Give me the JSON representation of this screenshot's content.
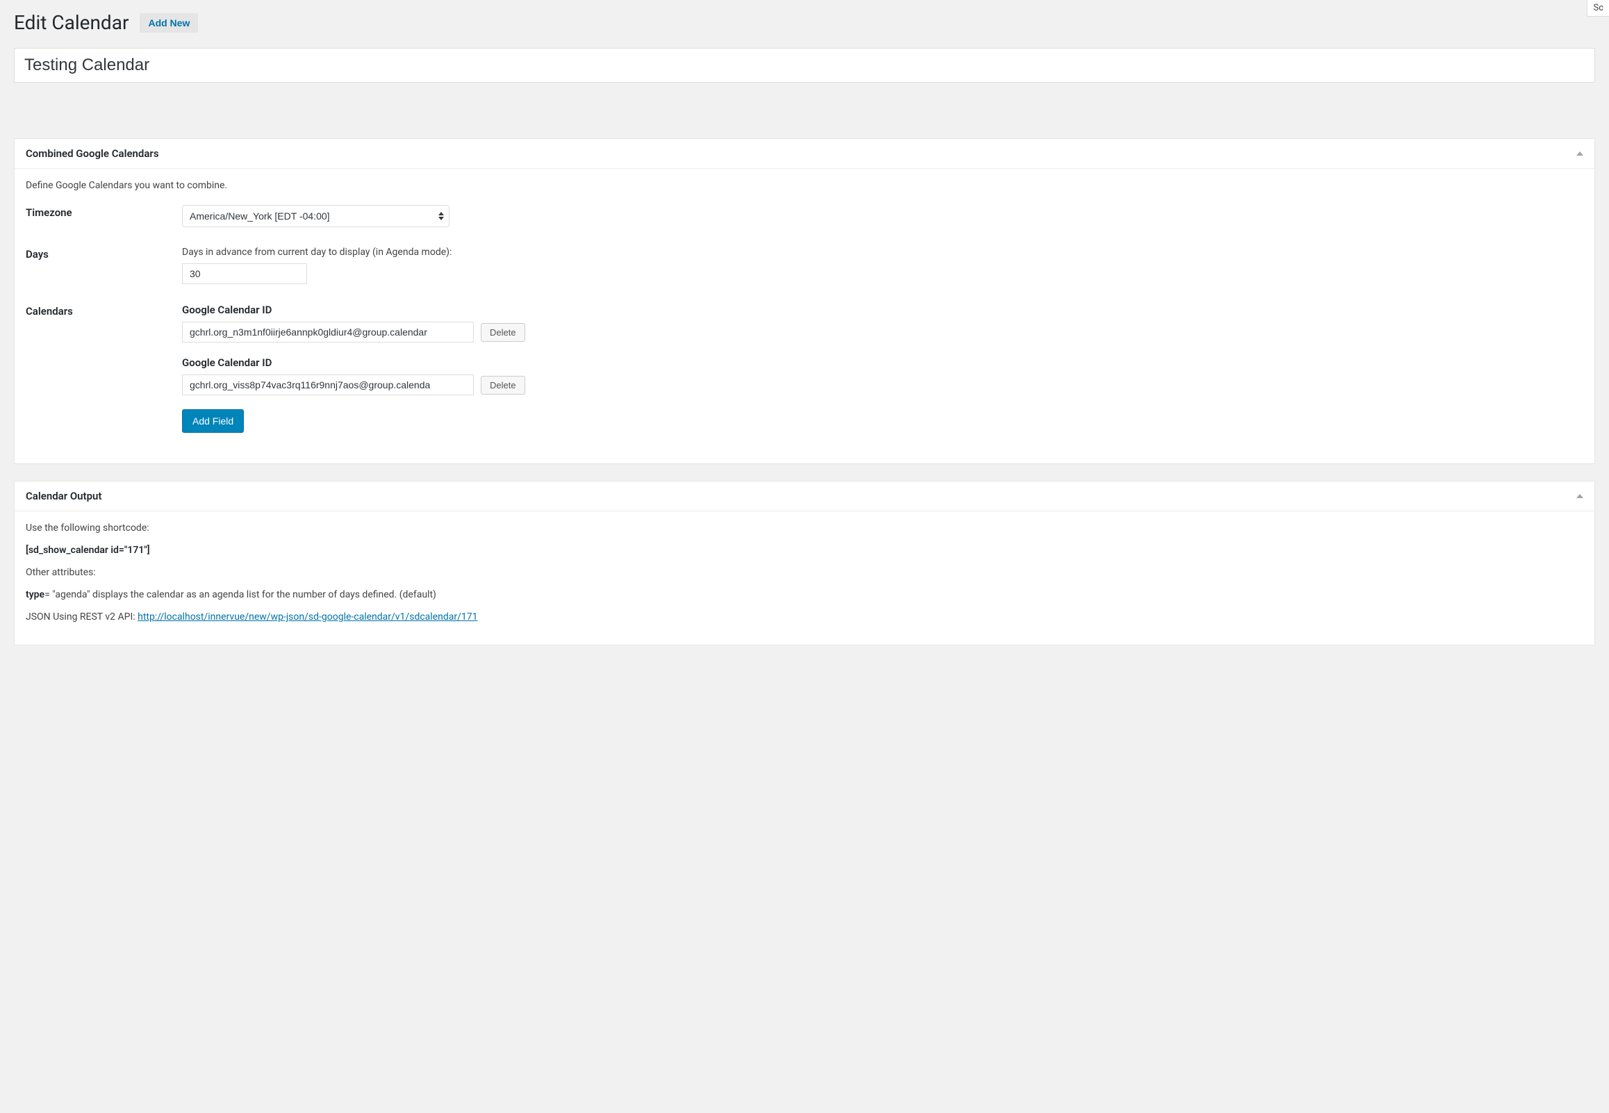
{
  "header": {
    "page_title": "Edit Calendar",
    "add_new_label": "Add New",
    "top_tab": "Sc"
  },
  "title_input": {
    "value": "Testing Calendar"
  },
  "combined_box": {
    "title": "Combined Google Calendars",
    "description": "Define Google Calendars you want to combine.",
    "timezone_label": "Timezone",
    "timezone_value": "America/New_York [EDT -04:00]",
    "days_label": "Days",
    "days_help": "Days in advance from current day to display (in Agenda mode):",
    "days_value": "30",
    "calendars_label": "Calendars",
    "calendar_id_label": "Google Calendar ID",
    "calendars": [
      {
        "value": "gchrl.org_n3m1nf0iirje6annpk0gldiur4@group.calendar",
        "delete_label": "Delete"
      },
      {
        "value": "gchrl.org_viss8p74vac3rq116r9nnj7aos@group.calenda",
        "delete_label": "Delete"
      }
    ],
    "add_field_label": "Add Field"
  },
  "output_box": {
    "title": "Calendar Output",
    "shortcode_intro": "Use the following shortcode:",
    "shortcode": "[sd_show_calendar id=\"171\"]",
    "other_attrs_label": "Other attributes:",
    "type_label": "type",
    "type_desc": " = \"agenda\" displays the calendar as an agenda list for the number of days defined. (default)",
    "json_label": "JSON Using REST v2 API: ",
    "json_link": "http://localhost/innervue/new/wp-json/sd-google-calendar/v1/sdcalendar/171"
  }
}
